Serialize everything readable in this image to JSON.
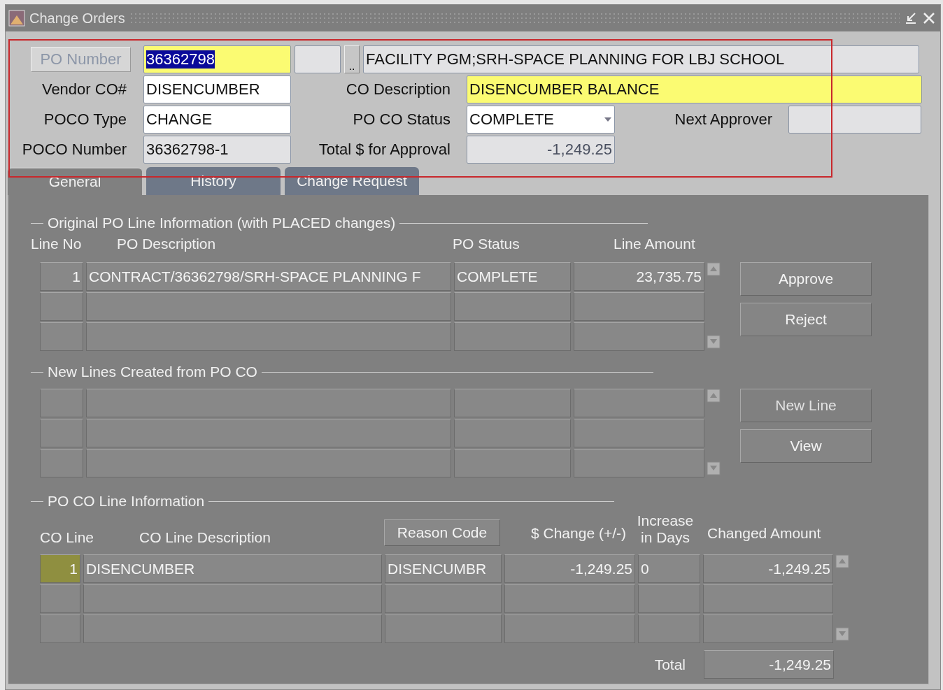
{
  "window": {
    "title": "Change Orders"
  },
  "header": {
    "po_number": {
      "button": "PO Number",
      "value": "36362798",
      "text_selected": true
    },
    "po_lookup": {
      "button": ".."
    },
    "po_description": {
      "value": "FACILITY PGM;SRH-SPACE PLANNING FOR LBJ SCHOOL"
    },
    "vendor_co": {
      "label": "Vendor CO#",
      "value": "DISENCUMBER"
    },
    "co_description": {
      "label": "CO Description",
      "value": "DISENCUMBER BALANCE"
    },
    "poco_type": {
      "label": "POCO Type",
      "value": "CHANGE"
    },
    "po_co_status": {
      "label": "PO CO Status",
      "value": "COMPLETE"
    },
    "next_approver": {
      "label": "Next Approver"
    },
    "poco_number": {
      "label": "POCO Number",
      "value": "36362798-1"
    },
    "total_for_approval": {
      "label": "Total $ for Approval",
      "value": "-1,249.25"
    }
  },
  "tabs": [
    {
      "label": "General",
      "selected": true
    },
    {
      "label": "History",
      "selected": false
    },
    {
      "label": "Change Request",
      "selected": false
    }
  ],
  "original_po_lines": {
    "title": "Original PO Line Information (with PLACED changes)",
    "columns": [
      "Line No",
      "PO Description",
      "PO Status",
      "Line Amount"
    ],
    "rows": [
      {
        "line_no": "1",
        "description": "CONTRACT/36362798/SRH-SPACE PLANNING F",
        "status": "COMPLETE",
        "amount": "23,735.75"
      }
    ],
    "buttons": [
      {
        "label": "Approve",
        "disabled": false
      },
      {
        "label": "Reject",
        "disabled": false
      }
    ]
  },
  "new_lines": {
    "title": "New Lines Created from PO CO",
    "buttons": [
      {
        "label": "New Line",
        "disabled": true
      },
      {
        "label": "View",
        "disabled": false
      }
    ]
  },
  "po_co_lines": {
    "title": "PO CO Line Information",
    "columns": {
      "co_line": "CO Line",
      "description": "CO Line Description",
      "reason_code": "Reason Code",
      "change": "$ Change (+/-)",
      "days_top": "Increase",
      "days_bottom": "in Days",
      "changed_amount": "Changed Amount"
    },
    "rows": [
      {
        "co_line": "1",
        "description": "DISENCUMBER",
        "reason_code": "DISENCUMBR",
        "change": "-1,249.25",
        "days": "0",
        "changed_amount": "-1,249.25",
        "current": true
      }
    ],
    "total_label": "Total",
    "total": "-1,249.25"
  }
}
